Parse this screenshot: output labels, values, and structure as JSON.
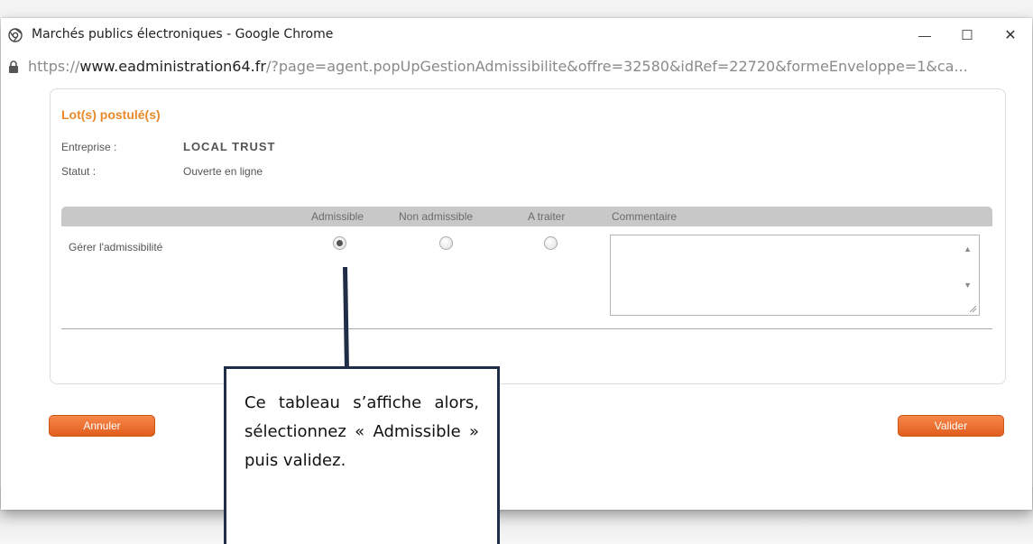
{
  "window": {
    "title": "Marchés publics électroniques - Google Chrome",
    "controls": {
      "minimize": "—",
      "maximize": "☐",
      "close": "✕"
    }
  },
  "address_bar": {
    "url_prefix": "https://",
    "url_host": "www.eadministration64.fr",
    "url_rest": "/?page=agent.popUpGestionAdmissibilite&offre=32580&idRef=22720&formeEnveloppe=1&ca..."
  },
  "panel": {
    "title": "Lot(s) postulé(s)",
    "fields": [
      {
        "label": "Entreprise :",
        "value": "LOCAL TRUST"
      },
      {
        "label": "Statut :",
        "value": "Ouverte en ligne"
      }
    ]
  },
  "table": {
    "columns": [
      "Admissible",
      "Non admissible",
      "A traiter",
      "Commentaire"
    ],
    "row_label": "Gérer l'admissibilité",
    "selected": "Admissible",
    "comment": ""
  },
  "buttons": {
    "cancel": "Annuler",
    "submit": "Valider"
  },
  "callout": {
    "text": "Ce tableau s’affiche alors, sélectionnez « Admissible » puis validez."
  },
  "colors": {
    "accent_orange": "#e88a2a",
    "button_orange": "#f06a2c",
    "callout_border": "#1f2d46"
  }
}
